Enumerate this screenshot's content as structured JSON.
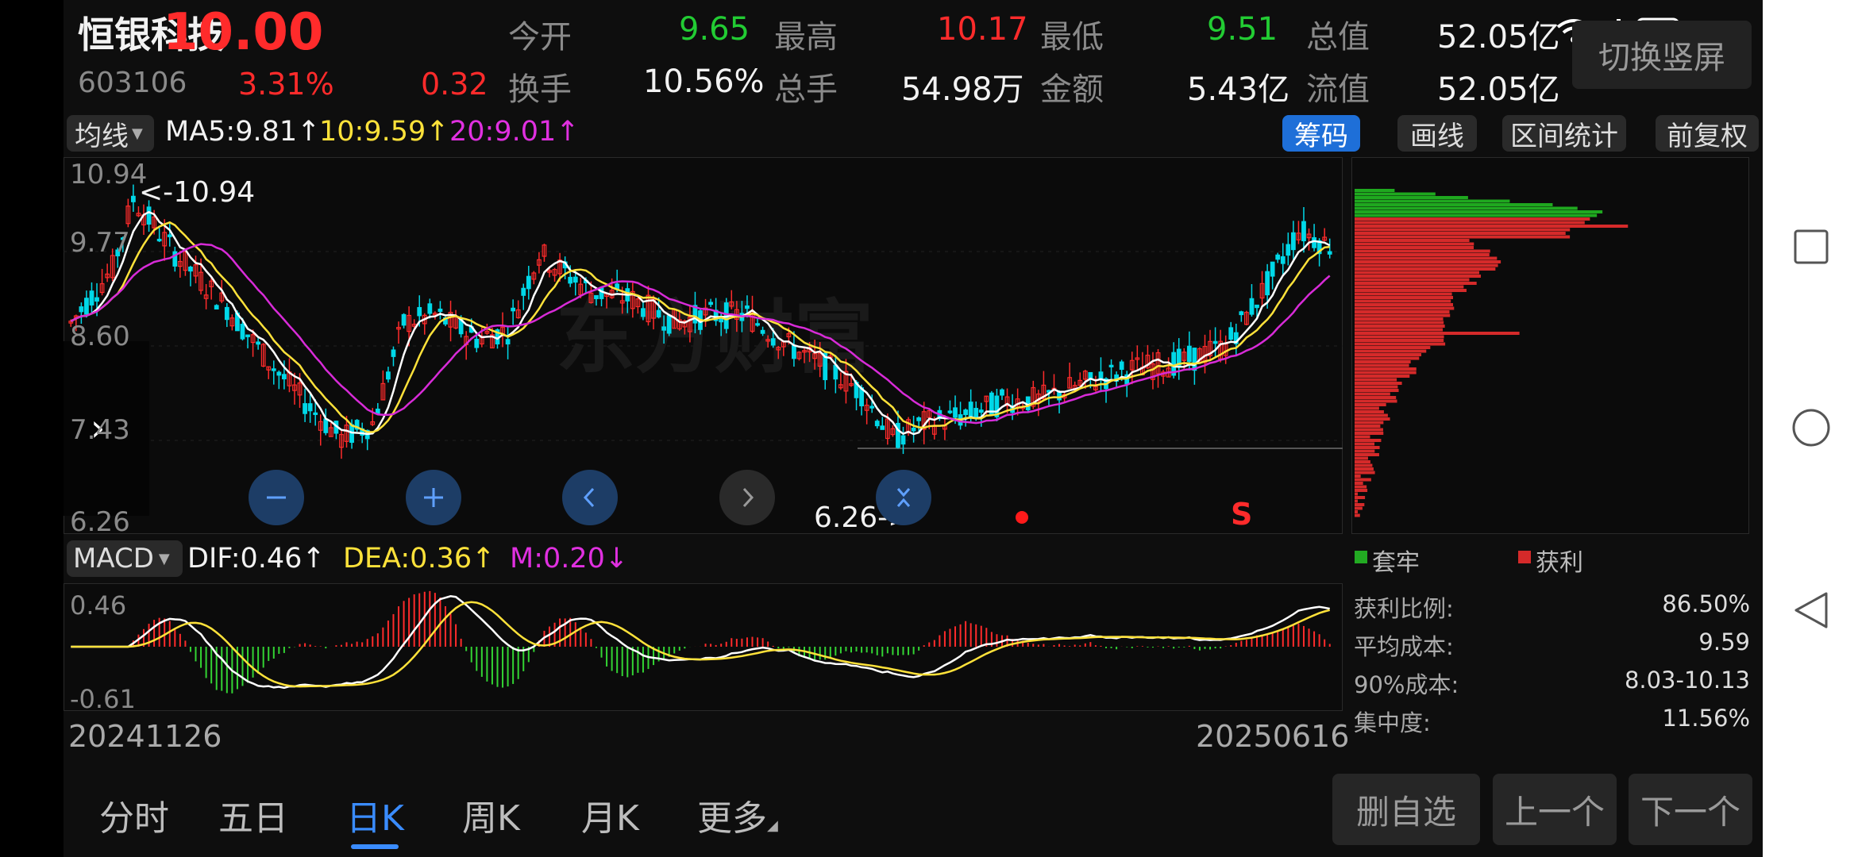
{
  "stock": {
    "name": "恒银科技",
    "code": "603106",
    "price": "10.00",
    "change_pct": "3.31%",
    "change": "0.32"
  },
  "quote": [
    {
      "label": "今开",
      "value": "9.65"
    },
    {
      "label": "最高",
      "value": "10.17"
    },
    {
      "label": "最低",
      "value": "9.51"
    },
    {
      "label": "总值",
      "value": "52.05亿"
    },
    {
      "label": "换手",
      "value": "10.56%"
    },
    {
      "label": "总手",
      "value": "54.98万"
    },
    {
      "label": "金额",
      "value": "5.43亿"
    },
    {
      "label": "流值",
      "value": "52.05亿"
    }
  ],
  "switch_btn": "切换竖屏",
  "ma_bar": {
    "selector": "均线",
    "ma5": "MA5:9.81↑",
    "ma10": "10:9.59↑",
    "ma20": "20:9.01↑"
  },
  "toolbar": [
    "筹码",
    "画线",
    "区间统计",
    "前复权"
  ],
  "kline": {
    "y_ticks": [
      "10.94",
      "9.77",
      "8.60",
      "7.43",
      "6.26"
    ],
    "high_mark": "<-10.94",
    "low_mark": "6.26->",
    "signal": "S"
  },
  "macd": {
    "selector": "MACD",
    "dif": "DIF:0.46↑",
    "dea": "DEA:0.36↑",
    "m": "M:0.20↓",
    "y_top": "0.46",
    "y_bottom": "-0.61"
  },
  "dates": {
    "start": "20241126",
    "end": "20250616"
  },
  "chip": {
    "legend_trap": "套牢",
    "legend_profit": "获利",
    "rows": [
      {
        "label": "获利比例:",
        "value": "86.50%"
      },
      {
        "label": "平均成本:",
        "value": "9.59"
      },
      {
        "label": "90%成本:",
        "value": "8.03-10.13"
      },
      {
        "label": "集中度:",
        "value": "11.56%"
      }
    ]
  },
  "tabs": [
    "分时",
    "五日",
    "日K",
    "周K",
    "月K",
    "更多"
  ],
  "active_tab": "日K",
  "actions": [
    "删自选",
    "上一个",
    "下一个"
  ],
  "colors": {
    "up": "#ff2b2b",
    "down": "#00d8e8",
    "ma5": "#ffffff",
    "ma10": "#ffe23a",
    "ma20": "#d82bd8",
    "accent": "#1e6fd8"
  }
}
